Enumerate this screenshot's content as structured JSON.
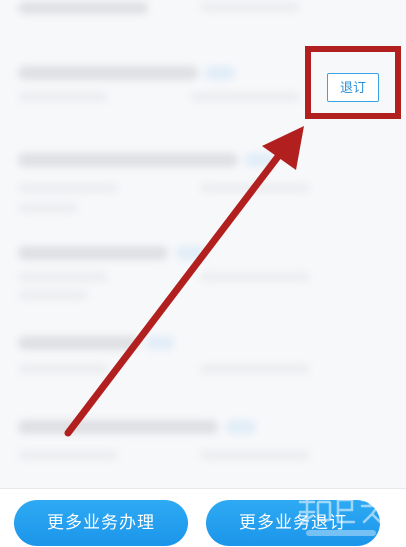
{
  "list": {
    "unsubscribe_label": "退订"
  },
  "bottom_bar": {
    "more_services_label": "更多业务办理",
    "more_unsubscribe_label": "更多业务退订"
  },
  "annotation": {
    "highlight_color": "#b21f1f",
    "arrow_color": "#b21f1f"
  },
  "watermark": {
    "icon": "zhijia-logo-icon"
  }
}
